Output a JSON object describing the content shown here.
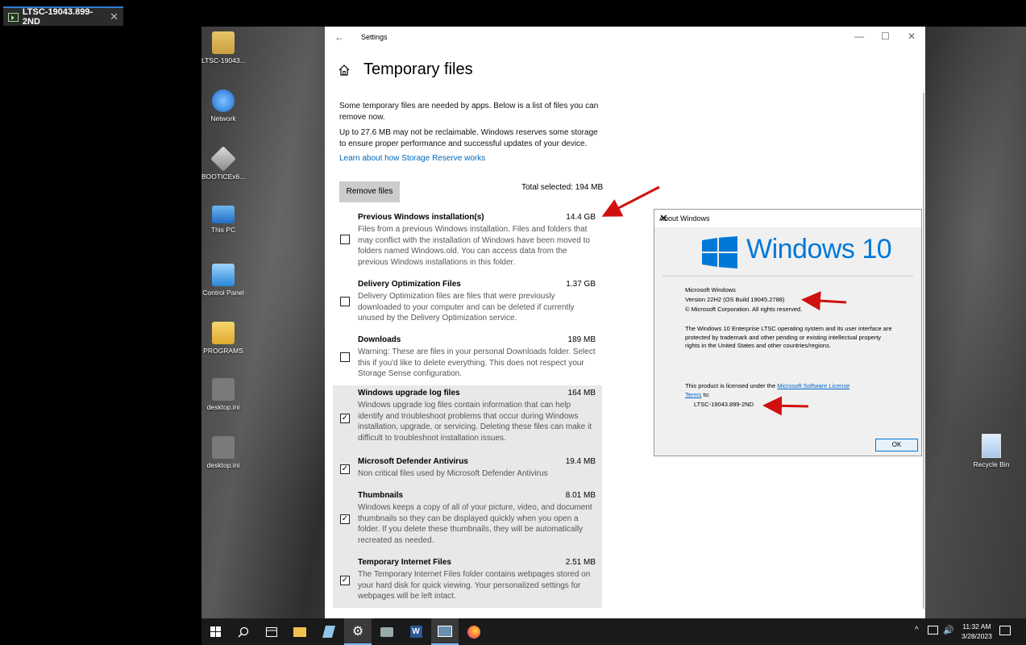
{
  "host": {
    "tab_title": "LTSC-19043.899-2ND",
    "close": "✕"
  },
  "desktop": {
    "icons": [
      {
        "label": "LTSC-19043..."
      },
      {
        "label": "Network"
      },
      {
        "label": "BOOTICEx6..."
      },
      {
        "label": "This PC"
      },
      {
        "label": "Control Panel"
      },
      {
        "label": "PROGRAMS"
      },
      {
        "label": "desktop.ini"
      },
      {
        "label": "desktop.ini"
      }
    ],
    "recycle_bin": "Recycle Bin"
  },
  "settings": {
    "window_title": "Settings",
    "page_title": "Temporary files",
    "intro": "Some temporary files are needed by apps. Below is a list of files you can remove now.",
    "reserve_note": "Up to 27.6 MB may not be reclaimable. Windows reserves some storage to ensure proper performance and successful updates of your device.",
    "learn_link": "Learn about how Storage Reserve works",
    "remove_button": "Remove files",
    "total_selected": "Total selected: 194 MB",
    "items": [
      {
        "name": "Previous Windows installation(s)",
        "size": "14.4 GB",
        "checked": false,
        "check": "",
        "description": "Files from a previous Windows installation.  Files and folders that may conflict with the installation of Windows have been moved to folders named Windows.old.  You can access data from the previous Windows installations in this folder."
      },
      {
        "name": "Delivery Optimization Files",
        "size": "1.37 GB",
        "checked": false,
        "check": "",
        "description": "Delivery Optimization files are files that were previously downloaded to your computer and can be deleted if currently unused by the Delivery Optimization service."
      },
      {
        "name": "Downloads",
        "size": "189 MB",
        "checked": false,
        "check": "",
        "description": "Warning: These are files in your personal Downloads folder. Select this if you'd like to delete everything. This does not respect your Storage Sense configuration."
      },
      {
        "name": "Windows upgrade log files",
        "size": "164 MB",
        "checked": true,
        "check": "✓",
        "description": "Windows upgrade log files contain information that can help identify and troubleshoot problems that occur during Windows installation, upgrade, or servicing.  Deleting these files can make it difficult to troubleshoot installation issues."
      },
      {
        "name": "Microsoft Defender Antivirus",
        "size": "19.4 MB",
        "checked": true,
        "check": "✓",
        "description": "Non critical files used by Microsoft Defender Antivirus"
      },
      {
        "name": "Thumbnails",
        "size": "8.01 MB",
        "checked": true,
        "check": "✓",
        "description": "Windows keeps a copy of all of your picture, video, and document thumbnails so they can be displayed quickly when you open a folder. If you delete these thumbnails, they will be automatically recreated as needed."
      },
      {
        "name": "Temporary Internet Files",
        "size": "2.51 MB",
        "checked": true,
        "check": "✓",
        "description": "The Temporary Internet Files folder contains webpages stored on your hard disk for quick viewing. Your personalized settings for webpages will be left intact."
      }
    ]
  },
  "about": {
    "title": "About Windows",
    "logo_text": "Windows 10",
    "product": "Microsoft Windows",
    "version": "Version 22H2 (OS Build 19045.2788)",
    "copyright": "© Microsoft Corporation. All rights reserved.",
    "legal": "The Windows 10 Enterprise LTSC operating system and its user interface are protected by trademark and other pending or existing intellectual property rights in the United States and other countries/regions.",
    "license_prefix": "This product is licensed under the ",
    "license_link": "Microsoft Software License Terms",
    "license_suffix": " to:",
    "licensee": "LTSC-19043.899-2ND",
    "ok": "OK"
  },
  "taskbar": {
    "time": "11:32 AM",
    "date": "3/28/2023"
  },
  "colors": {
    "accent": "#0078d7",
    "link": "#0067b8",
    "arrow": "#d01010"
  }
}
